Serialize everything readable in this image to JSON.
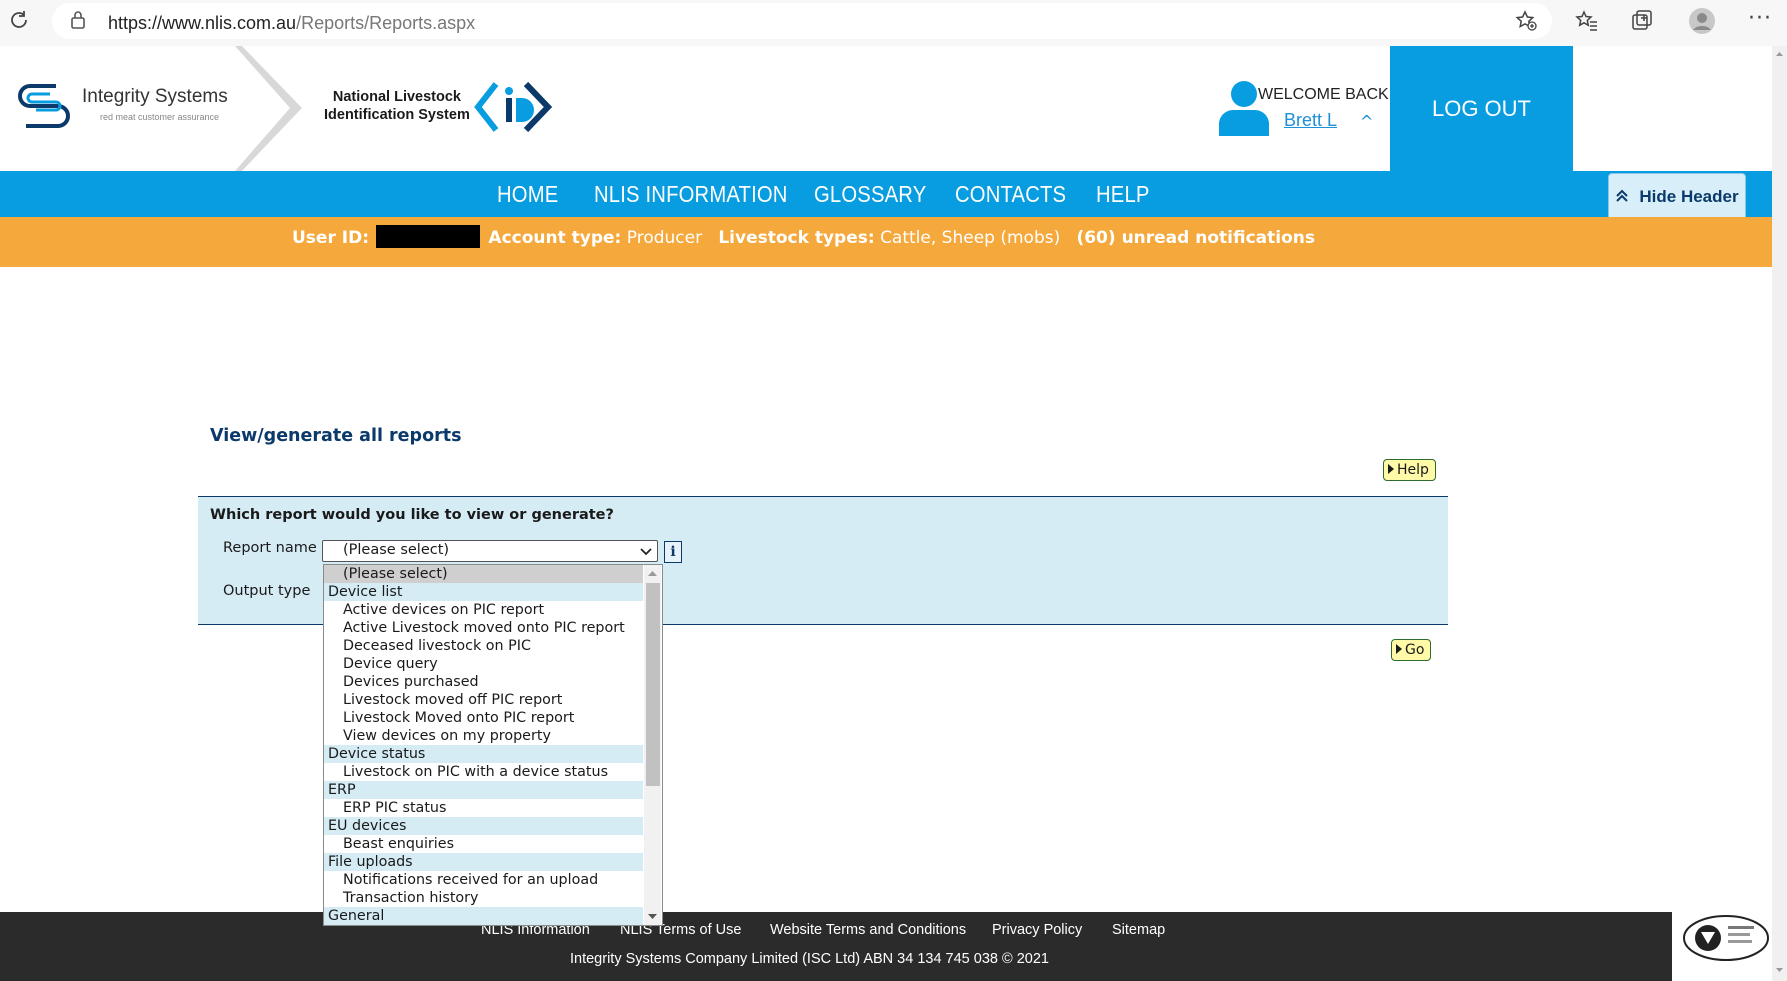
{
  "browser": {
    "url_prefix": "https://www.nlis.com.au",
    "url_path": "/Reports/Reports.aspx"
  },
  "header": {
    "logo_name": "Integrity Systems",
    "logo_tagline": "red meat customer assurance",
    "nlis_line1": "National Livestock",
    "nlis_line2": "Identification System",
    "welcome": "WELCOME BACK",
    "username": "Brett L",
    "logout": "LOG OUT",
    "hide_header": "Hide Header"
  },
  "nav": {
    "items": [
      "HOME",
      "NLIS INFORMATION",
      "GLOSSARY",
      "CONTACTS",
      "HELP"
    ]
  },
  "infobar": {
    "user_id_label": "User ID:",
    "account_label": "Account type:",
    "account_value": "Producer",
    "livestock_label": "Livestock types:",
    "livestock_value": "Cattle, Sheep (mobs)",
    "notifications": "(60) unread notifications"
  },
  "main": {
    "title": "View/generate all reports",
    "help_button": "Help",
    "question": "Which report would you like to view or generate?",
    "report_label": "Report name",
    "output_label": "Output type",
    "selected_value": "(Please select)",
    "info_icon": "i",
    "go_button": "Go"
  },
  "dropdown": {
    "options": [
      {
        "kind": "sel",
        "label": "(Please select)"
      },
      {
        "kind": "group",
        "label": "Device list"
      },
      {
        "kind": "item",
        "label": "Active devices on PIC report"
      },
      {
        "kind": "item",
        "label": "Active Livestock moved onto PIC report"
      },
      {
        "kind": "item",
        "label": "Deceased livestock on PIC"
      },
      {
        "kind": "item",
        "label": "Device query"
      },
      {
        "kind": "item",
        "label": "Devices purchased"
      },
      {
        "kind": "item",
        "label": "Livestock moved off PIC report"
      },
      {
        "kind": "item",
        "label": "Livestock Moved onto PIC report"
      },
      {
        "kind": "item",
        "label": "View devices on my property"
      },
      {
        "kind": "group",
        "label": "Device status"
      },
      {
        "kind": "item",
        "label": "Livestock on PIC with a device status"
      },
      {
        "kind": "group",
        "label": "ERP"
      },
      {
        "kind": "item",
        "label": "ERP PIC status"
      },
      {
        "kind": "group",
        "label": "EU devices"
      },
      {
        "kind": "item",
        "label": "Beast enquiries"
      },
      {
        "kind": "group",
        "label": "File uploads"
      },
      {
        "kind": "item",
        "label": "Notifications received for an upload"
      },
      {
        "kind": "item",
        "label": "Transaction history"
      },
      {
        "kind": "group",
        "label": "General"
      }
    ]
  },
  "footer": {
    "links": [
      "NLIS Information",
      "NLIS Terms of Use",
      "Website Terms and Conditions",
      "Privacy Policy",
      "Sitemap"
    ],
    "copyright": "Integrity Systems Company Limited (ISC Ltd) ABN 34 134 745 038 © 2021"
  },
  "colors": {
    "nav_blue": "#079de0",
    "info_orange": "#f5a83b",
    "form_bg": "#d5ecf5",
    "title_navy": "#0b3a6a"
  }
}
